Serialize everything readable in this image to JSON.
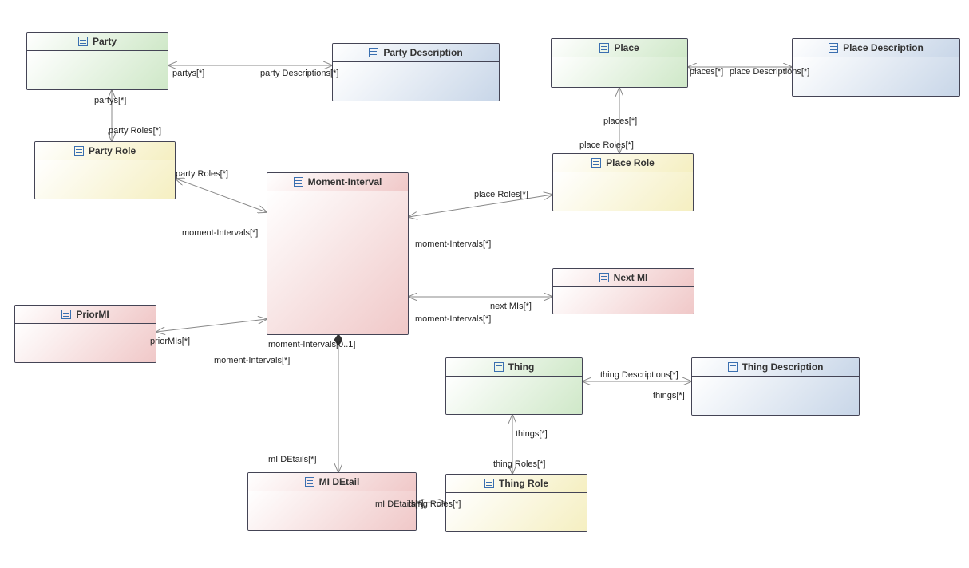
{
  "classes": {
    "party": {
      "label": "Party"
    },
    "partyDesc": {
      "label": "Party Description"
    },
    "partyRole": {
      "label": "Party Role"
    },
    "place": {
      "label": "Place"
    },
    "placeDesc": {
      "label": "Place Description"
    },
    "placeRole": {
      "label": "Place Role"
    },
    "moment": {
      "label": "Moment-Interval"
    },
    "priorMI": {
      "label": "PriorMI"
    },
    "nextMI": {
      "label": "Next MI"
    },
    "miDetail": {
      "label": "MI DEtail"
    },
    "thing": {
      "label": "Thing"
    },
    "thingDesc": {
      "label": "Thing Description"
    },
    "thingRole": {
      "label": "Thing Role"
    }
  },
  "labels": {
    "partys1": "partys[*]",
    "partys2": "partys[*]",
    "partyDescs": "party Descriptions[*]",
    "partyRoles1": "party Roles[*]",
    "partyRoles2": "party Roles[*]",
    "momentIntervals1": "moment-Intervals[*]",
    "momentIntervals2": "moment-Intervals[*]",
    "momentIntervals3": "moment-Intervals[*]",
    "momentIntervals4": "moment-Intervals[*]",
    "momentIntervals01": "moment-Intervals[0..1]",
    "places": "places[*]",
    "placeDescs": "place Descriptions[*]",
    "placeRoles1": "place Roles[*]",
    "placeRoles2": "place Roles[*]",
    "priorMIs": "priorMIs[*]",
    "nextMIs": "next MIs[*]",
    "mIDetails1": "mI DEtails[*]",
    "mIDetails2": "mI DEtails[*]",
    "things1": "things[*]",
    "things2": "things[*]",
    "thingDescs": "thing Descriptions[*]",
    "thingRoles1": "thing Roles[*]",
    "thingRoles2": "thing Roles[*]"
  }
}
